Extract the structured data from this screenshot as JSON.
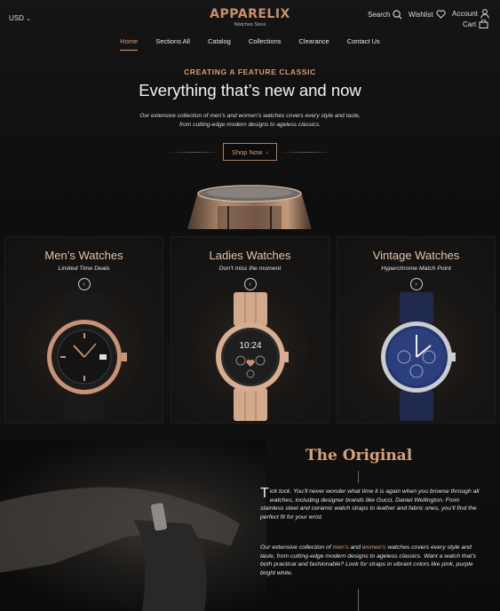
{
  "header": {
    "currency": "USD",
    "logo": "APPARELIX",
    "logo_sub": "Watches Store",
    "search_label": "Search",
    "wishlist_label": "Wishlist",
    "account_label": "Account",
    "cart_label": "Cart"
  },
  "nav": {
    "items": [
      "Home",
      "Sections All",
      "Catalog",
      "Collections",
      "Clearance",
      "Contact Us"
    ],
    "active": "Home"
  },
  "hero": {
    "eyebrow": "CREATING A FEATURE CLASSIC",
    "title": "Everything that’s new and now",
    "description": "Our extensive collection of men’s and women’s watches covers every style and taste, from cutting-edge modern designs to ageless classics.",
    "button": "Shop Now",
    "button_icon": "›"
  },
  "cards": [
    {
      "title": "Men’s Watches",
      "subtitle": "Limited Time Deals",
      "icon": "›"
    },
    {
      "title": "Ladies Watches",
      "subtitle": "Don’t miss the moment",
      "icon": "›",
      "watch_time": "10:24"
    },
    {
      "title": "Vintage Watches",
      "subtitle": "Hyperchrome Match Point",
      "icon": "›"
    }
  ],
  "original": {
    "title": "The Original",
    "p1_dropcap": "T",
    "p1_rest": "ick tock. You’ll never wonder what time it is again when you browse through all watches, including designer brands like Gucci, Daniel Wellington. From stainless steel and ceramic watch straps to leather and fabric ones, you’ll find the perfect fit for your wrist.",
    "p2_a": "Our extensive collection of ",
    "p2_men": "men’s",
    "p2_and": " and ",
    "p2_women": "women’s",
    "p2_b": " watches covers every style and taste, from cutting-edge modern designs to ageless classics. Want a watch that’s both practical and fashionable? Look for straps in vibrant colors like pink, purple bright white."
  },
  "colors": {
    "accent": "#d79c73",
    "background": "#0e0e0e"
  }
}
